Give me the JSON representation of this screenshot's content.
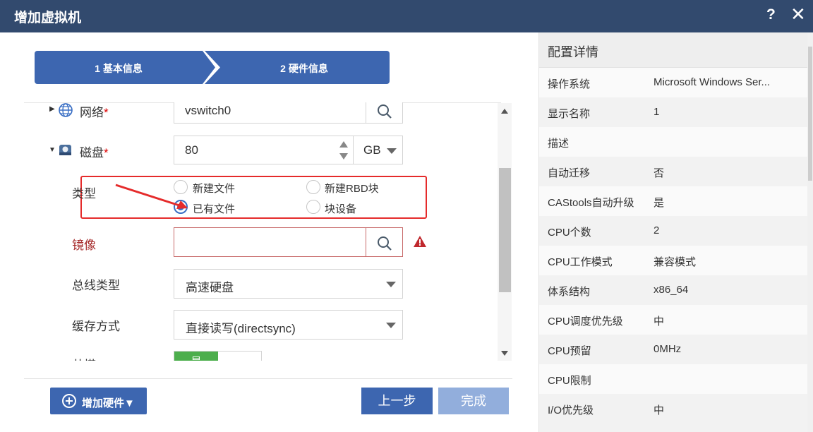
{
  "window": {
    "title": "增加虚拟机",
    "help_label": "?",
    "close_label": "✕"
  },
  "steps": [
    {
      "label": "1 基本信息"
    },
    {
      "label": "2 硬件信息"
    }
  ],
  "form": {
    "network": {
      "label": "网络",
      "required": "*",
      "value": "vswitch0"
    },
    "disk": {
      "label": "磁盘",
      "required": "*",
      "value": "80",
      "unit": "GB"
    },
    "type": {
      "label": "类型",
      "options": [
        {
          "label": "新建文件",
          "selected": false
        },
        {
          "label": "新建RBD块",
          "selected": false
        },
        {
          "label": "已有文件",
          "selected": true
        },
        {
          "label": "块设备",
          "selected": false
        }
      ]
    },
    "image": {
      "label": "镜像",
      "value": ""
    },
    "bus_type": {
      "label": "总线类型",
      "value": "高速硬盘"
    },
    "cache_mode": {
      "label": "缓存方式",
      "value": "直接读写(directsync)"
    },
    "partial_row": {
      "label": "共搭",
      "toggle_label": "是"
    }
  },
  "footer": {
    "add_hardware": "增加硬件▼",
    "prev": "上一步",
    "finish": "完成"
  },
  "details": {
    "title": "配置详情",
    "rows": [
      {
        "key": "操作系统",
        "value": "Microsoft Windows Ser..."
      },
      {
        "key": "显示名称",
        "value": "1"
      },
      {
        "key": "描述",
        "value": ""
      },
      {
        "key": "自动迁移",
        "value": "否"
      },
      {
        "key": "CAStools自动升级",
        "value": "是"
      },
      {
        "key": "CPU个数",
        "value": "2"
      },
      {
        "key": "CPU工作模式",
        "value": "兼容模式"
      },
      {
        "key": "体系结构",
        "value": "x86_64"
      },
      {
        "key": "CPU调度优先级",
        "value": "中"
      },
      {
        "key": "CPU预留",
        "value": "0MHz"
      },
      {
        "key": "CPU限制",
        "value": ""
      },
      {
        "key": "I/O优先级",
        "value": "中"
      }
    ]
  },
  "colors": {
    "titlebar": "#324a6e",
    "primary": "#3d66b0",
    "highlight_box": "#e52b2b",
    "error_label": "#a52a2a",
    "warning": "#c0282d"
  }
}
